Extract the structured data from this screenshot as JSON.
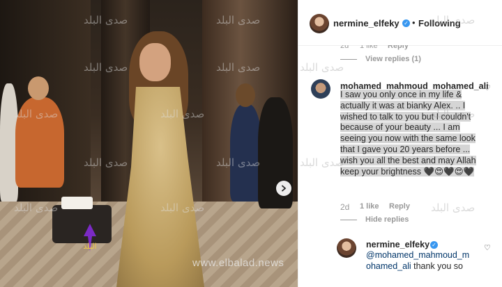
{
  "post": {
    "watermark_url": "www.elbalad.news",
    "watermark_text": "صدى البلد",
    "logo_text": "البلد"
  },
  "header": {
    "username": "nermine_elfeky",
    "separator": "•",
    "follow_label": "Following"
  },
  "previous_comment": {
    "time": "2d",
    "likes": "1 like",
    "reply_label": "Reply",
    "view_replies": "View replies (1)"
  },
  "comment": {
    "username": "mohamed_mahmoud_mohamed_ali",
    "text": "I saw you only once in my life & actually it was at bianky Alex. .. I wished to talk to you but I couldn't because of your beauty ... I am seeing you now with the same look that I gave you 20 years before ... wish you all the best and may Allah keep your brightness 🖤😍🖤😍🖤",
    "time": "2d",
    "likes": "1 like",
    "reply_label": "Reply",
    "hide_replies": "Hide replies"
  },
  "reply": {
    "username": "nermine_elfeky",
    "mention": "@mohamed_mahmoud_m ohamed_ali",
    "text": " thank you so"
  },
  "icons": {
    "verified": "verified-badge-icon",
    "heart": "heart-outline-icon",
    "next": "chevron-right-icon"
  },
  "colors": {
    "verified_blue": "#3897f0",
    "meta_gray": "#999999",
    "text_dark": "#262626",
    "mention_blue": "#003569"
  }
}
